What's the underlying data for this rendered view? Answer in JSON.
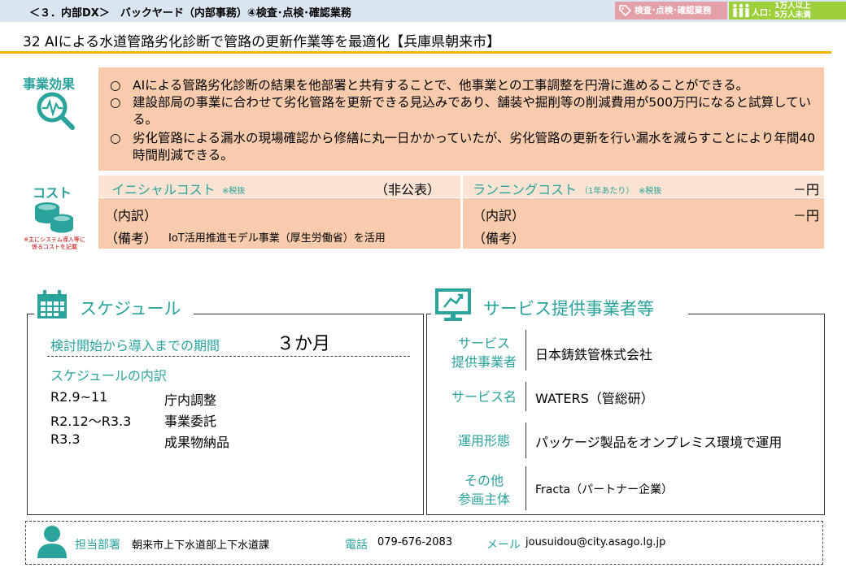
{
  "header": {
    "title": "＜３．内部DX＞　バックヤード（内部事務）④検査･点検･確認業務",
    "tag_category": "検査･点検･確認業務",
    "population_label": "人口：",
    "population_l1": "1万人以上",
    "population_l2": "5万人未満"
  },
  "case_title": "32  AIによる水道管路劣化診断で管路の更新作業等を最適化【兵庫県朝来市】",
  "effect": {
    "label": "事業効果",
    "bullet": "○",
    "items": [
      "AIによる管路劣化診断の結果を他部署と共有することで、他事業との工事調整を円滑に進めることができる。",
      "建設部局の事業に合わせて劣化管路を更新できる見込みであり、舗装や掘削等の削減費用が500万円になると試算している。",
      "劣化管路による漏水の現場確認から修繕に丸一日かかっていたが、劣化管路の更新を行い漏水を減らすことにより年間40時間削減できる。"
    ]
  },
  "cost": {
    "label": "コスト",
    "note": "※主にシステム導入等に係るコストを記載",
    "initial_title": "イニシャルコスト",
    "initial_tax": "※税抜",
    "initial_value": "（非公表）",
    "initial_breakdown": "（内訳）",
    "initial_remark": "（備考）",
    "initial_remark_text": "IoT活用推進モデル事業（厚生労働省）を活用",
    "running_title": "ランニングコスト",
    "running_period": "（1年あたり）",
    "running_tax": "※税抜",
    "running_value": "－円",
    "running_breakdown": "（内訳）",
    "running_breakdown_value": "－円",
    "running_remark": "（備考）"
  },
  "schedule": {
    "title": "スケジュール",
    "period_label": "検討開始から導入までの期間",
    "period_value": "３か月",
    "breakdown_label": "スケジュールの内訳",
    "rows": [
      {
        "date": "R2.9~11",
        "item": "庁内調整"
      },
      {
        "date": "R2.12～R3.3",
        "item": "事業委託"
      },
      {
        "date": "R3.3",
        "item": "成果物納品"
      }
    ]
  },
  "provider": {
    "title": "サービス提供事業者等",
    "rows": [
      {
        "label_l1": "サービス",
        "label_l2": "提供事業者",
        "value": "日本鋳鉄管株式会社"
      },
      {
        "label_l1": "サービス名",
        "label_l2": "",
        "value": "WATERS（管総研）"
      },
      {
        "label_l1": "運用形態",
        "label_l2": "",
        "value": "パッケージ製品をオンプレミス環境で運用"
      },
      {
        "label_l1": "その他",
        "label_l2": "参画主体",
        "value": "Fracta（パートナー企業）"
      }
    ]
  },
  "contact": {
    "dept_label": "担当部署",
    "dept_value": "朝来市上下水道部上下水道課",
    "tel_label": "電話",
    "tel_value": "079-676-2083",
    "mail_label": "メール",
    "mail_value": "jousuidou@city.asago.lg.jp"
  },
  "colors": {
    "accent": "#2aa39b",
    "effect_bg": "#f8cbad",
    "gold": "#f0b400",
    "header_bg": "#dbe5f1"
  },
  "icons": [
    "magnifier-chart-icon",
    "coins-icon",
    "calendar-icon",
    "monitor-icon",
    "person-icon",
    "tag-icon",
    "people-icon"
  ]
}
